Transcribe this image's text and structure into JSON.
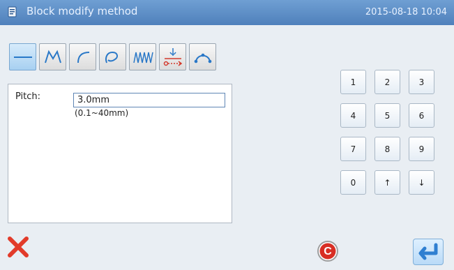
{
  "title": "Block modify method",
  "timestamp": "2015-08-18 10:04",
  "modes": [
    {
      "name": "straight-line-icon"
    },
    {
      "name": "polyline-icon"
    },
    {
      "name": "arc-icon"
    },
    {
      "name": "curve-icon"
    },
    {
      "name": "zigzag-icon"
    },
    {
      "name": "needle-feed-icon"
    },
    {
      "name": "point-arc-icon"
    }
  ],
  "form": {
    "pitch_label": "Pitch:",
    "pitch_value": "3.0mm",
    "pitch_range": "(0.1~40mm)"
  },
  "keypad": {
    "keys": [
      "1",
      "2",
      "3",
      "4",
      "5",
      "6",
      "7",
      "8",
      "9",
      "0",
      "↑",
      "↓"
    ]
  },
  "buttons": {
    "cancel": "cancel-icon",
    "clear": "C",
    "enter": "enter-icon"
  },
  "colors": {
    "titlebar": "#5b8ac5",
    "active_mode": "#b6dcf8",
    "cancel": "#e23b2a",
    "clear_accent": "#d82e24",
    "enter_accent": "#2f7fd1"
  }
}
